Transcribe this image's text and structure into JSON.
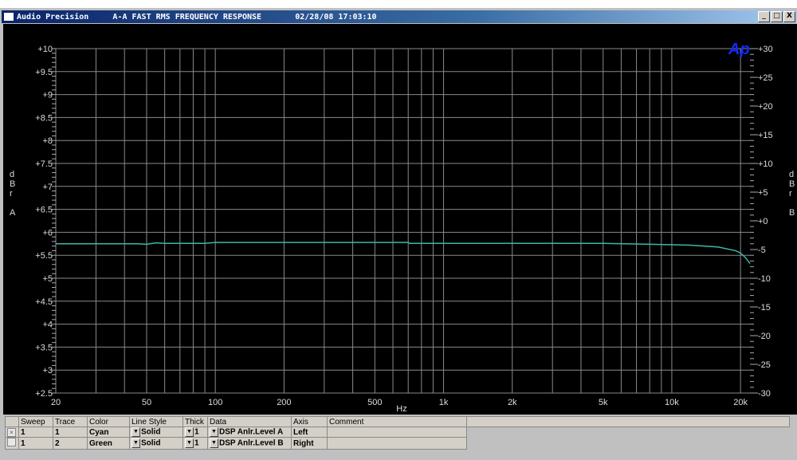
{
  "window": {
    "app": "Audio Precision",
    "test": "A-A FAST RMS FREQUENCY RESPONSE",
    "timestamp": "02/28/08 17:03:10",
    "buttons": [
      "_",
      "□",
      "X"
    ]
  },
  "logo": "Ap",
  "left_axis_label": [
    "d",
    "B",
    "r",
    "A"
  ],
  "right_axis_label": [
    "d",
    "B",
    "r",
    "B"
  ],
  "chart_data": {
    "type": "line",
    "xlabel": "Hz",
    "xscale": "log",
    "xlim": [
      20,
      22000
    ],
    "x_ticks": [
      {
        "v": 20,
        "label": "20"
      },
      {
        "v": 50,
        "label": "50"
      },
      {
        "v": 100,
        "label": "100"
      },
      {
        "v": 200,
        "label": "200"
      },
      {
        "v": 500,
        "label": "500"
      },
      {
        "v": 1000,
        "label": "1k"
      },
      {
        "v": 2000,
        "label": "2k"
      },
      {
        "v": 5000,
        "label": "5k"
      },
      {
        "v": 10000,
        "label": "10k"
      },
      {
        "v": 20000,
        "label": "20k"
      }
    ],
    "ylim_left": [
      2.5,
      10
    ],
    "y_ticks_left": [
      "+2.5",
      "+3",
      "+3.5",
      "+4",
      "+4.5",
      "+5",
      "+5.5",
      "+6",
      "+6.5",
      "+7",
      "+7.5",
      "+8",
      "+8.5",
      "+9",
      "+9.5",
      "+10"
    ],
    "ylim_right": [
      -30,
      30
    ],
    "y_ticks_right": [
      "-30",
      "-25",
      "-20",
      "-15",
      "-10",
      "-5",
      "+0",
      "+5",
      "+10",
      "+15",
      "+20",
      "+25",
      "+30"
    ],
    "grid": true,
    "series": [
      {
        "name": "DSP Anlr.Level A",
        "color": "#3cb8a8",
        "axis": "left",
        "x": [
          20,
          45,
          50,
          55,
          60,
          90,
          100,
          700,
          710,
          5000,
          8000,
          12000,
          16000,
          19000,
          20000,
          21000,
          22000
        ],
        "y": [
          5.75,
          5.75,
          5.74,
          5.77,
          5.76,
          5.76,
          5.78,
          5.78,
          5.76,
          5.76,
          5.74,
          5.72,
          5.68,
          5.6,
          5.55,
          5.45,
          5.32
        ]
      }
    ]
  },
  "legend_table": {
    "headers": [
      "",
      "Sweep",
      "Trace",
      "Color",
      "Line Style",
      "Thick",
      "Data",
      "Axis",
      "Comment"
    ],
    "rows": [
      {
        "checked": true,
        "sweep": "1",
        "trace": "1",
        "color": "Cyan",
        "style": "Solid",
        "thick": "1",
        "data": "DSP Anlr.Level A",
        "axis": "Left",
        "comment": ""
      },
      {
        "checked": false,
        "sweep": "1",
        "trace": "2",
        "color": "Green",
        "style": "Solid",
        "thick": "1",
        "data": "DSP Anlr.Level B",
        "axis": "Right",
        "comment": ""
      }
    ]
  }
}
